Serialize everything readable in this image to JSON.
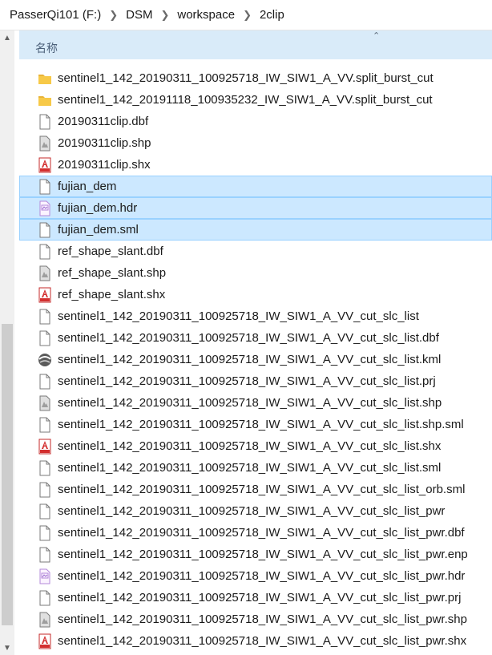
{
  "breadcrumb": [
    "PasserQi101 (F:)",
    "DSM",
    "workspace",
    "2clip"
  ],
  "header": {
    "name_label": "名称"
  },
  "files": [
    {
      "name": "sentinel1_142_20190311_100925718_IW_SIW1_A_VV.split_burst_cut",
      "icon": "folder",
      "selected": false
    },
    {
      "name": "sentinel1_142_20191118_100935232_IW_SIW1_A_VV.split_burst_cut",
      "icon": "folder",
      "selected": false
    },
    {
      "name": "20190311clip.dbf",
      "icon": "blank",
      "selected": false
    },
    {
      "name": "20190311clip.shp",
      "icon": "shp",
      "selected": false
    },
    {
      "name": "20190311clip.shx",
      "icon": "shx",
      "selected": false
    },
    {
      "name": "fujian_dem",
      "icon": "blank",
      "selected": true
    },
    {
      "name": "fujian_dem.hdr",
      "icon": "hdr",
      "selected": true
    },
    {
      "name": "fujian_dem.sml",
      "icon": "blank",
      "selected": true
    },
    {
      "name": "ref_shape_slant.dbf",
      "icon": "blank",
      "selected": false
    },
    {
      "name": "ref_shape_slant.shp",
      "icon": "shp",
      "selected": false
    },
    {
      "name": "ref_shape_slant.shx",
      "icon": "shx",
      "selected": false
    },
    {
      "name": "sentinel1_142_20190311_100925718_IW_SIW1_A_VV_cut_slc_list",
      "icon": "blank",
      "selected": false
    },
    {
      "name": "sentinel1_142_20190311_100925718_IW_SIW1_A_VV_cut_slc_list.dbf",
      "icon": "blank",
      "selected": false
    },
    {
      "name": "sentinel1_142_20190311_100925718_IW_SIW1_A_VV_cut_slc_list.kml",
      "icon": "kml",
      "selected": false
    },
    {
      "name": "sentinel1_142_20190311_100925718_IW_SIW1_A_VV_cut_slc_list.prj",
      "icon": "blank",
      "selected": false
    },
    {
      "name": "sentinel1_142_20190311_100925718_IW_SIW1_A_VV_cut_slc_list.shp",
      "icon": "shp",
      "selected": false
    },
    {
      "name": "sentinel1_142_20190311_100925718_IW_SIW1_A_VV_cut_slc_list.shp.sml",
      "icon": "blank",
      "selected": false
    },
    {
      "name": "sentinel1_142_20190311_100925718_IW_SIW1_A_VV_cut_slc_list.shx",
      "icon": "shx",
      "selected": false
    },
    {
      "name": "sentinel1_142_20190311_100925718_IW_SIW1_A_VV_cut_slc_list.sml",
      "icon": "blank",
      "selected": false
    },
    {
      "name": "sentinel1_142_20190311_100925718_IW_SIW1_A_VV_cut_slc_list_orb.sml",
      "icon": "blank",
      "selected": false
    },
    {
      "name": "sentinel1_142_20190311_100925718_IW_SIW1_A_VV_cut_slc_list_pwr",
      "icon": "blank",
      "selected": false
    },
    {
      "name": "sentinel1_142_20190311_100925718_IW_SIW1_A_VV_cut_slc_list_pwr.dbf",
      "icon": "blank",
      "selected": false
    },
    {
      "name": "sentinel1_142_20190311_100925718_IW_SIW1_A_VV_cut_slc_list_pwr.enp",
      "icon": "blank",
      "selected": false
    },
    {
      "name": "sentinel1_142_20190311_100925718_IW_SIW1_A_VV_cut_slc_list_pwr.hdr",
      "icon": "hdr",
      "selected": false
    },
    {
      "name": "sentinel1_142_20190311_100925718_IW_SIW1_A_VV_cut_slc_list_pwr.prj",
      "icon": "blank",
      "selected": false
    },
    {
      "name": "sentinel1_142_20190311_100925718_IW_SIW1_A_VV_cut_slc_list_pwr.shp",
      "icon": "shp",
      "selected": false
    },
    {
      "name": "sentinel1_142_20190311_100925718_IW_SIW1_A_VV_cut_slc_list_pwr.shx",
      "icon": "shx",
      "selected": false
    }
  ],
  "colors": {
    "selection_bg": "#cce8ff",
    "selection_border": "#99d1ff",
    "header_bg": "#d9ebf9",
    "folder": "#f5c542",
    "shx_red": "#d32f2f"
  }
}
